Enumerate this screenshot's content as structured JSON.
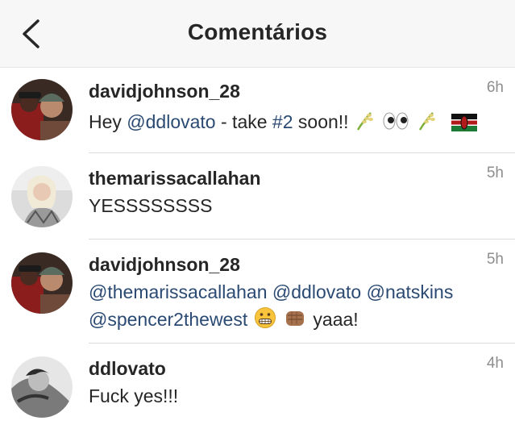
{
  "header": {
    "title": "Comentários",
    "back_icon": "chevron-left-icon"
  },
  "comments": [
    {
      "username": "davidjohnson_28",
      "time": "6h",
      "parts": [
        {
          "type": "text",
          "value": "Hey "
        },
        {
          "type": "mention",
          "value": "@ddlovato"
        },
        {
          "type": "text",
          "value": " - take "
        },
        {
          "type": "hashtag",
          "value": "#2"
        },
        {
          "type": "text",
          "value": " soon!! "
        }
      ],
      "emojis": [
        "rice-plant-emoji",
        "eyes-emoji",
        "rice-plant-emoji",
        "kenya-flag-emoji"
      ]
    },
    {
      "username": "themarissacallahan",
      "time": "5h",
      "text": "YESSSSSSSS"
    },
    {
      "username": "davidjohnson_28",
      "time": "5h",
      "mentions_line1": [
        "@themarissacallahan",
        "@ddlovato",
        "@natskins"
      ],
      "mention_line2": "@spencer2thewest",
      "emojis": [
        "grimacing-face-emoji",
        "fist-bump-emoji"
      ],
      "tail_text": "yaaa!"
    },
    {
      "username": "ddlovato",
      "time": "4h",
      "text": "Fuck yes!!!"
    }
  ],
  "colors": {
    "link": "#2b4a73",
    "username": "#262626",
    "timestamp": "#8e8e8e",
    "header_bg": "#f7f7f7"
  }
}
